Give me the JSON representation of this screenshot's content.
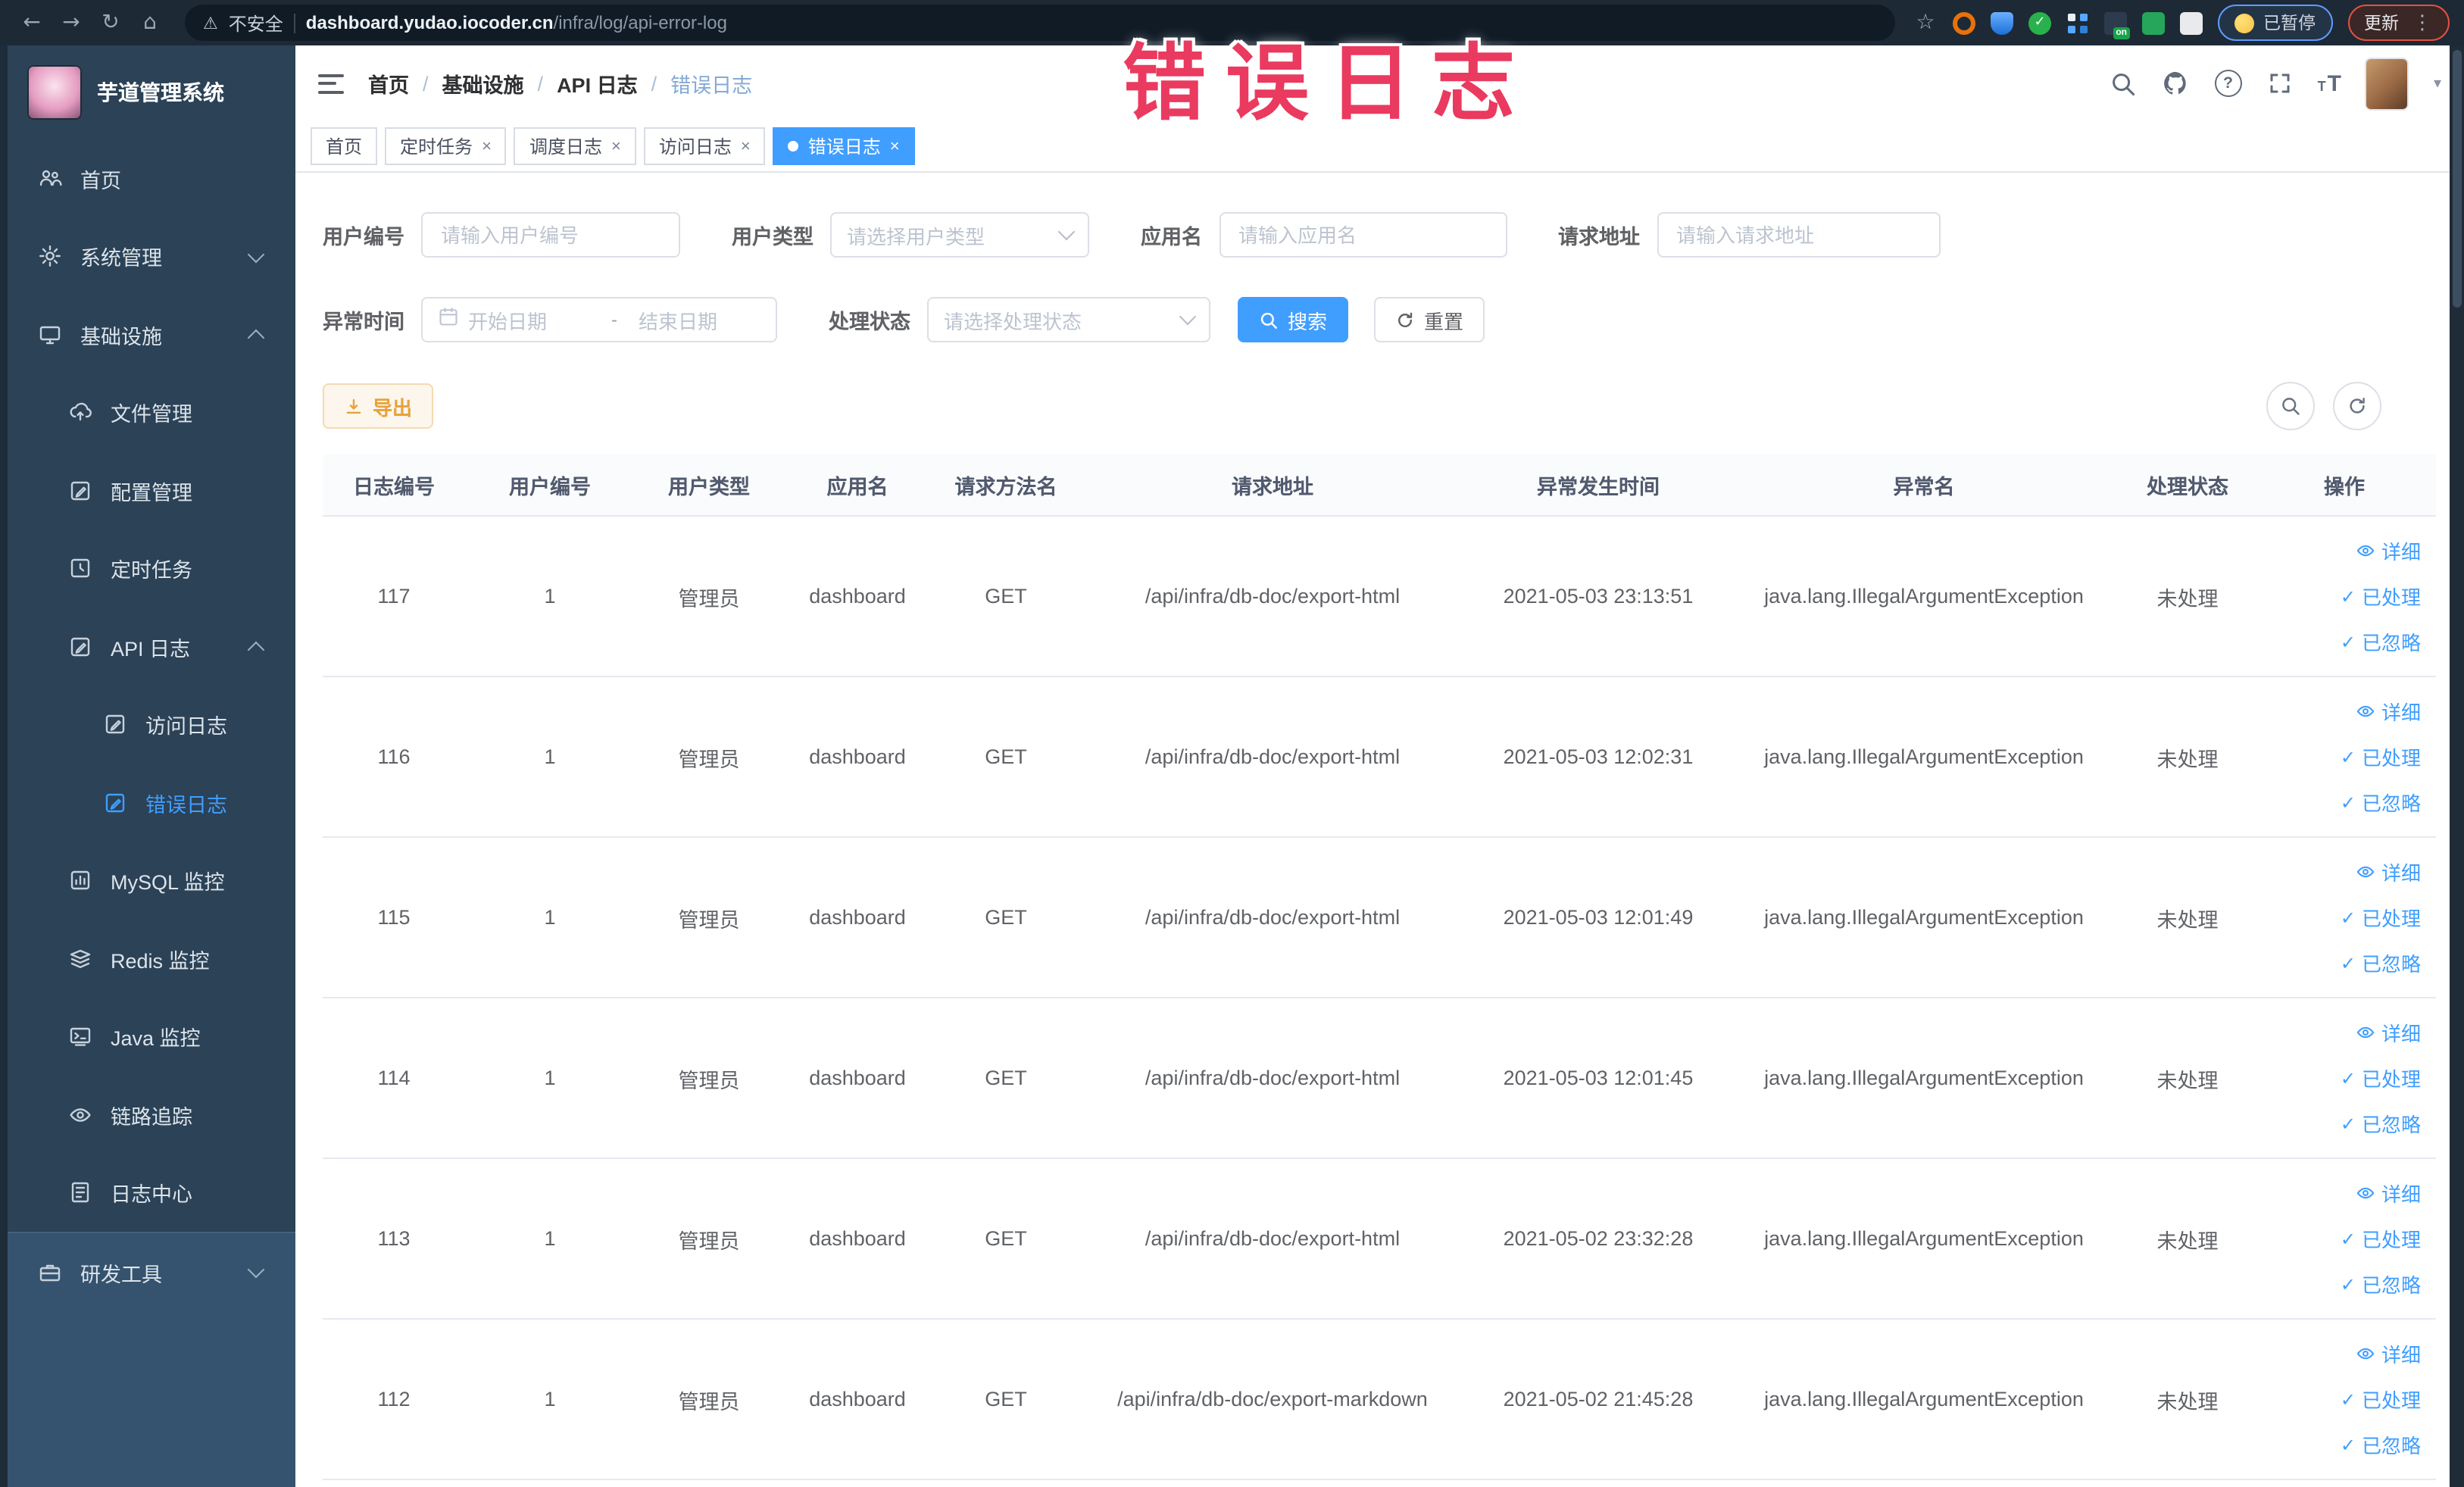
{
  "browser": {
    "security_label": "不安全",
    "url_host": "dashboard.yudao.iocoder.cn",
    "url_path": "/infra/log/api-error-log",
    "paused_chip_label": "已暂停",
    "update_button_label": "更新"
  },
  "overlay": {
    "text": "错误日志"
  },
  "colors": {
    "accent_blue": "#409eff",
    "export_orange": "#e6a23c",
    "overlay_red": "#ea3a5f",
    "sidebar_bg": "#2b4257",
    "browser_bar_bg": "#1d2935"
  },
  "sidebar": {
    "app_title": "芋道管理系统",
    "items": [
      {
        "label": "首页",
        "icon": "users-icon"
      },
      {
        "label": "系统管理",
        "icon": "gear-icon",
        "chevron": "down"
      },
      {
        "label": "基础设施",
        "icon": "monitor-icon",
        "chevron": "up"
      },
      {
        "label": "文件管理",
        "icon": "cloud-upload-icon"
      },
      {
        "label": "配置管理",
        "icon": "edit-square-icon"
      },
      {
        "label": "定时任务",
        "icon": "clock-square-icon"
      },
      {
        "label": "API 日志",
        "icon": "edit-square-icon",
        "chevron": "up"
      },
      {
        "label": "访问日志",
        "icon": "edit-square-icon"
      },
      {
        "label": "错误日志",
        "icon": "edit-square-icon",
        "active": true
      },
      {
        "label": "MySQL 监控",
        "icon": "bar-chart-icon"
      },
      {
        "label": "Redis 监控",
        "icon": "layers-icon"
      },
      {
        "label": "Java 监控",
        "icon": "terminal-icon"
      },
      {
        "label": "链路追踪",
        "icon": "eye-icon"
      },
      {
        "label": "日志中心",
        "icon": "document-icon"
      },
      {
        "label": "研发工具",
        "icon": "briefcase-icon",
        "chevron": "down"
      }
    ]
  },
  "header": {
    "breadcrumb": [
      "首页",
      "基础设施",
      "API 日志",
      "错误日志"
    ]
  },
  "tabs": [
    {
      "label": "首页",
      "closable": false,
      "active": false
    },
    {
      "label": "定时任务",
      "closable": true,
      "active": false
    },
    {
      "label": "调度日志",
      "closable": true,
      "active": false
    },
    {
      "label": "访问日志",
      "closable": true,
      "active": false
    },
    {
      "label": "错误日志",
      "closable": true,
      "active": true
    }
  ],
  "filters": {
    "user_id": {
      "label": "用户编号",
      "placeholder": "请输入用户编号"
    },
    "user_type": {
      "label": "用户类型",
      "placeholder": "请选择用户类型"
    },
    "app_name": {
      "label": "应用名",
      "placeholder": "请输入应用名"
    },
    "request_url": {
      "label": "请求地址",
      "placeholder": "请输入请求地址"
    },
    "exception_time": {
      "label": "异常时间",
      "start_placeholder": "开始日期",
      "separator": "-",
      "end_placeholder": "结束日期"
    },
    "process_status": {
      "label": "处理状态",
      "placeholder": "请选择处理状态"
    },
    "search_button": "搜索",
    "reset_button": "重置"
  },
  "toolbar": {
    "export_button": "导出"
  },
  "table": {
    "headers": [
      "日志编号",
      "用户编号",
      "用户类型",
      "应用名",
      "请求方法名",
      "请求地址",
      "异常发生时间",
      "异常名",
      "处理状态",
      "操作"
    ],
    "action_labels": {
      "detail": "详细",
      "processed": "已处理",
      "ignored": "已忽略"
    },
    "rows": [
      {
        "id": "117",
        "user_id": "1",
        "user_type": "管理员",
        "app": "dashboard",
        "method": "GET",
        "url": "/api/infra/db-doc/export-html",
        "time": "2021-05-03 23:13:51",
        "exception": "java.lang.IllegalArgumentException",
        "status": "未处理"
      },
      {
        "id": "116",
        "user_id": "1",
        "user_type": "管理员",
        "app": "dashboard",
        "method": "GET",
        "url": "/api/infra/db-doc/export-html",
        "time": "2021-05-03 12:02:31",
        "exception": "java.lang.IllegalArgumentException",
        "status": "未处理"
      },
      {
        "id": "115",
        "user_id": "1",
        "user_type": "管理员",
        "app": "dashboard",
        "method": "GET",
        "url": "/api/infra/db-doc/export-html",
        "time": "2021-05-03 12:01:49",
        "exception": "java.lang.IllegalArgumentException",
        "status": "未处理"
      },
      {
        "id": "114",
        "user_id": "1",
        "user_type": "管理员",
        "app": "dashboard",
        "method": "GET",
        "url": "/api/infra/db-doc/export-html",
        "time": "2021-05-03 12:01:45",
        "exception": "java.lang.IllegalArgumentException",
        "status": "未处理"
      },
      {
        "id": "113",
        "user_id": "1",
        "user_type": "管理员",
        "app": "dashboard",
        "method": "GET",
        "url": "/api/infra/db-doc/export-html",
        "time": "2021-05-02 23:32:28",
        "exception": "java.lang.IllegalArgumentException",
        "status": "未处理"
      },
      {
        "id": "112",
        "user_id": "1",
        "user_type": "管理员",
        "app": "dashboard",
        "method": "GET",
        "url": "/api/infra/db-doc/export-markdown",
        "time": "2021-05-02 21:45:28",
        "exception": "java.lang.IllegalArgumentException",
        "status": "未处理"
      }
    ]
  }
}
